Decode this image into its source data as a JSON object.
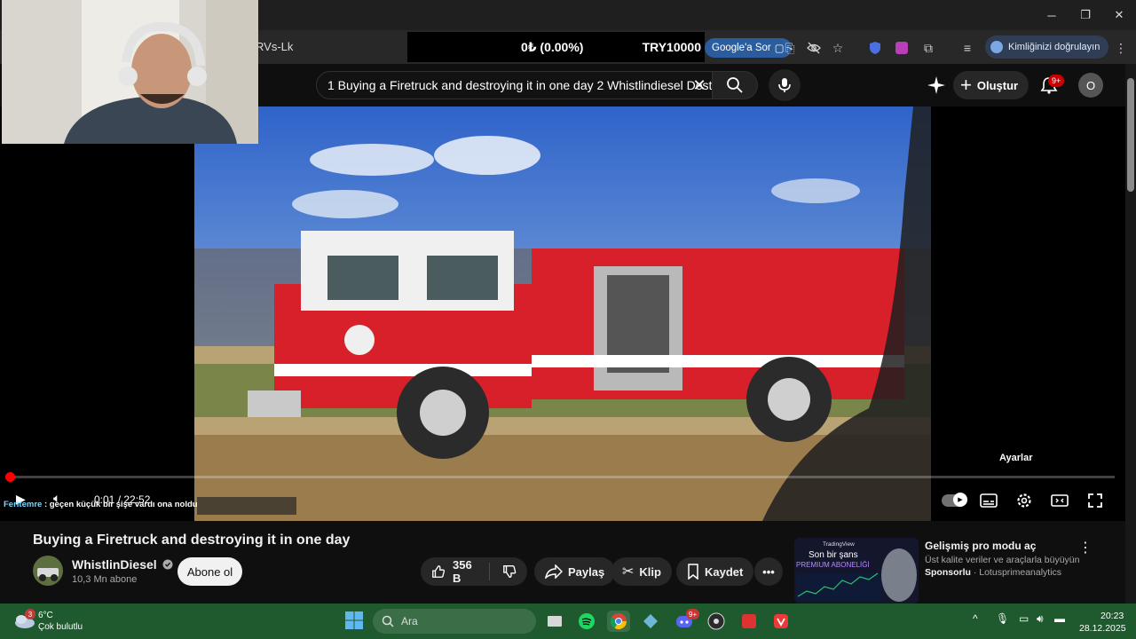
{
  "browser": {
    "tab_fragment": "RVs-Lk",
    "ticker_left": "0₺ (0.00%)",
    "ticker_right": "TRY10000",
    "google_ask": "Google'a Sor",
    "profile_label": "Kimliğinizi doğrulayın"
  },
  "header": {
    "search_query": "1 Buying a Firetruck and destroying it in one day 2 Whistlindiesel Dest",
    "create_label": "Oluştur",
    "notif_badge": "9+",
    "avatar_letter": "O"
  },
  "player": {
    "time": "0:01 / 22:52",
    "tooltip": "Ayarlar",
    "progress_fraction": 0.001,
    "chat_name": "Feritemre",
    "chat_text": " : geçen küçük bir şişe vardı ona noldu"
  },
  "video": {
    "title": "Buying a Firetruck and destroying it in one day",
    "channel_name": "WhistlinDiesel",
    "subscribers": "10,3 Mn abone",
    "subscribe_label": "Abone ol",
    "likes": "356 B",
    "share_label": "Paylaş",
    "clip_label": "Klip",
    "save_label": "Kaydet"
  },
  "ad": {
    "thumb_brand": "TradingView",
    "thumb_line1": "Son bir şans",
    "thumb_line2": "PREMIUM ABONELİĞİ",
    "title": "Gelişmiş pro modu aç",
    "description": "Üst kalite veriler ve araçlarla büyüyün",
    "sponsor_label": "Sponsorlu",
    "advertiser": " · Lotusprimeanalytics"
  },
  "taskbar": {
    "weather_temp": "6°C",
    "weather_desc": "Çok bulutlu",
    "weather_badge": "3",
    "search_label": "Ara",
    "discord_badge": "9+",
    "clock_time": "20:23",
    "clock_date": "28.12.2025"
  },
  "colors": {
    "youtube_red": "#ff0000",
    "taskbar": "#1f5a2e",
    "background": "#0f0f0f"
  }
}
